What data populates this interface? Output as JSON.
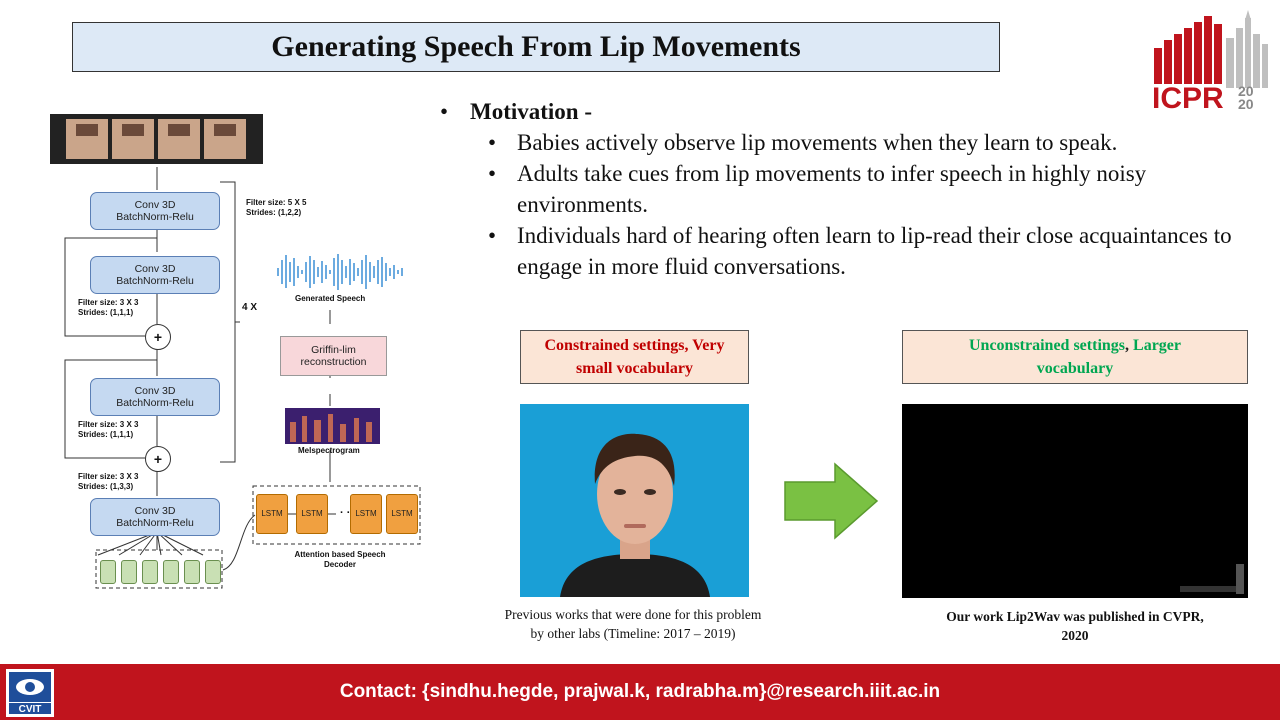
{
  "title": "Generating Speech From Lip Movements",
  "logo": {
    "text": "ICPR",
    "year_top": "20",
    "year_bottom": "20"
  },
  "motivation": {
    "heading": "Motivation -",
    "points": [
      "Babies actively observe lip movements when they learn to speak.",
      "Adults take cues from lip movements to infer speech in highly noisy environments.",
      "Individuals hard of hearing often learn to lip-read their close acquaintances to engage in more fluid conversations."
    ]
  },
  "diagram": {
    "blocks": [
      {
        "line1": "Conv 3D",
        "line2": "BatchNorm-Relu"
      },
      {
        "line1": "Conv 3D",
        "line2": "BatchNorm-Relu"
      },
      {
        "line1": "Conv 3D",
        "line2": "BatchNorm-Relu"
      },
      {
        "line1": "Conv 3D",
        "line2": "BatchNorm-Relu"
      }
    ],
    "filter_labels": [
      {
        "filter": "Filter size: 5 X 5",
        "strides": "Strides: (1,2,2)"
      },
      {
        "filter": "Filter size: 3 X 3",
        "strides": "Strides: (1,1,1)"
      },
      {
        "filter": "Filter size: 3 X 3",
        "strides": "Strides: (1,1,1)"
      },
      {
        "filter": "Filter size: 3 X 3",
        "strides": "Strides: (1,3,3)"
      }
    ],
    "repeat": "4 X",
    "generated_speech": "Generated Speech",
    "griffin_line1": "Griffin-lim",
    "griffin_line2": "reconstruction",
    "melspectrogram": "Melspectrogram",
    "lstm": "LSTM",
    "dots": "· · ·",
    "decoder_line1": "Attention based Speech",
    "decoder_line2": "Decoder",
    "plus": "+"
  },
  "left_label": {
    "line1": "Constrained settings, Very",
    "line2": "small vocabulary"
  },
  "right_label": {
    "part1": "Unconstrained settings",
    "comma": ", ",
    "part2": "Larger",
    "line2": "vocabulary"
  },
  "left_caption": {
    "line1": "Previous works that were done for this problem",
    "line2": "by other labs (Timeline: 2017 – 2019)"
  },
  "right_caption": {
    "line1": "Our work Lip2Wav was published in CVPR,",
    "line2": "2020"
  },
  "footer": {
    "contact": "Contact: {sindhu.hegde, prajwal.k, radrabha.m}@research.iiit.ac.in",
    "logo_text": "CVIT"
  },
  "colors": {
    "footer_red": "#c0141d",
    "title_bg": "#dde9f6",
    "label_bg": "#fbe5d6",
    "arrow_green": "#7ac143",
    "red_text": "#c00000",
    "green_text": "#00a651"
  }
}
